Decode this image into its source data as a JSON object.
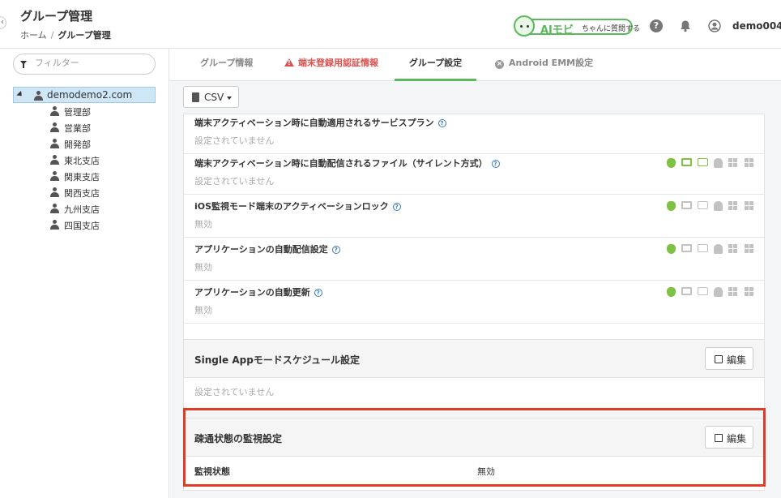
{
  "header": {
    "title": "グループ管理",
    "breadcrumb": {
      "home": "ホーム",
      "separator": "/",
      "current": "グループ管理"
    },
    "aimobi": {
      "label": "AIモビ",
      "sub": "ちゃんに質問する"
    },
    "help_icon": "?",
    "user_name": "demo004"
  },
  "sidebar": {
    "filter_placeholder": "フィルター",
    "root": "demodemo2.com",
    "items": [
      "管理部",
      "営業部",
      "開発部",
      "東北支店",
      "関東支店",
      "関西支店",
      "九州支店",
      "四国支店"
    ]
  },
  "tabs": [
    {
      "label": "グループ情報",
      "state": "normal"
    },
    {
      "label": "端末登録用認証情報",
      "state": "alert"
    },
    {
      "label": "グループ設定",
      "state": "active"
    },
    {
      "label": "Android EMM設定",
      "state": "disabled"
    }
  ],
  "csv_button": "CSV",
  "settings": [
    {
      "title": "端末アクティベーション時に自動適用されるサービスプラン",
      "value": "設定されていません",
      "os_icons": false
    },
    {
      "title": "端末アクティベーション時に自動配信されるファイル（サイレント方式）",
      "value": "設定されていません",
      "os_icons": true
    },
    {
      "title": "iOS監視モード端末のアクティベーションロック",
      "value": "無効",
      "os_icons": true
    },
    {
      "title": "アプリケーションの自動配信設定",
      "value": "無効",
      "os_icons": true
    },
    {
      "title": "アプリケーションの自動更新",
      "value": "無効",
      "os_icons": true
    }
  ],
  "single_app": {
    "title": "Single Appモードスケジュール設定",
    "edit_label": "編集",
    "empty_text": "設定されていません"
  },
  "monitor": {
    "title": "疎通状態の監視設定",
    "edit_label": "編集",
    "label": "監視状態",
    "value": "無効"
  },
  "colors": {
    "accent": "#5cb85c",
    "alert": "#d9534f",
    "highlight": "#e23b26",
    "os_active": "#7cc243",
    "os_inactive": "#c2c2c2"
  }
}
